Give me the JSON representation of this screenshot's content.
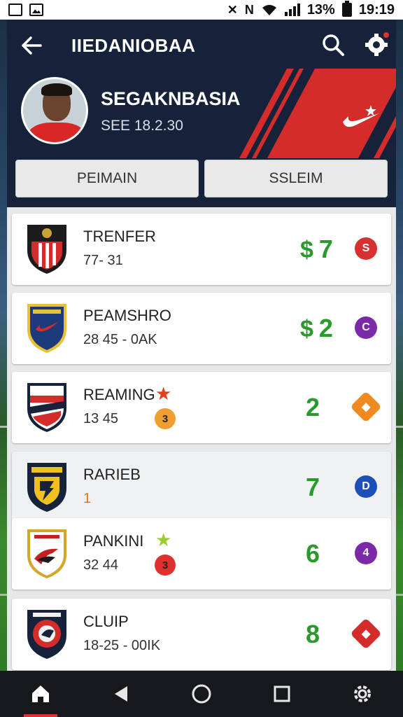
{
  "status_bar": {
    "battery": "13%",
    "time": "19:19"
  },
  "header": {
    "title": "IIEDANIOBAA",
    "player_name": "SEGAKNBASIA",
    "player_sub": "SEE 18.2.30",
    "tabs": [
      {
        "label": "PEIMAIN"
      },
      {
        "label": "SSLEIM"
      }
    ]
  },
  "clubs": [
    {
      "name": "TRENFER",
      "sub": "77- 31",
      "price_symbol": "$",
      "price": "7",
      "action_icon": "S",
      "action_color": "#d63030",
      "crest_colors": [
        "#d42b2b",
        "#1c1c1c",
        "#c9a23a"
      ],
      "star": "",
      "rank": ""
    },
    {
      "name": "PEAMSHRO",
      "sub": "28 45 - 0AK",
      "price_symbol": "$",
      "price": "2",
      "action_icon": "C",
      "action_color": "#7a2aa8",
      "crest_colors": [
        "#1d3a7a",
        "#e8c13a",
        "#d42b2b"
      ],
      "star": "",
      "rank": ""
    },
    {
      "name": "REAMING",
      "sub": "13 45",
      "price_symbol": "",
      "price": "2",
      "action_icon": "◆",
      "action_color": "#f08a20",
      "crest_colors": [
        "#d42b2b",
        "#16213a",
        "#ffffff"
      ],
      "star": "★",
      "star_color": "#e0401a",
      "rank": "3",
      "rank_color": "#f0a030"
    },
    {
      "name": "RARIEB",
      "sub": "1",
      "price_symbol": "",
      "price": "7",
      "action_icon": "D",
      "action_color": "#1d4fb8",
      "crest_colors": [
        "#16213a",
        "#f0c020",
        "#16213a"
      ],
      "star": "",
      "rank": ""
    },
    {
      "name": "PANKINI",
      "sub": "32 44",
      "price_symbol": "",
      "price": "6",
      "action_icon": "4",
      "action_color": "#7a2aa8",
      "crest_colors": [
        "#ffffff",
        "#d4a72b",
        "#c42020"
      ],
      "star": "★",
      "star_color": "#9acd32",
      "rank": "3",
      "rank_color": "#e03030"
    },
    {
      "name": "CLUIP",
      "sub": "18-25 - 00IK",
      "price_symbol": "",
      "price": "8",
      "action_icon": "◆",
      "action_color": "#d42b2b",
      "crest_colors": [
        "#16213a",
        "#d42b2b",
        "#f0f0f0"
      ],
      "star": "",
      "rank": ""
    }
  ],
  "nav": {
    "items": [
      "home",
      "back",
      "circle",
      "square",
      "settings"
    ]
  }
}
